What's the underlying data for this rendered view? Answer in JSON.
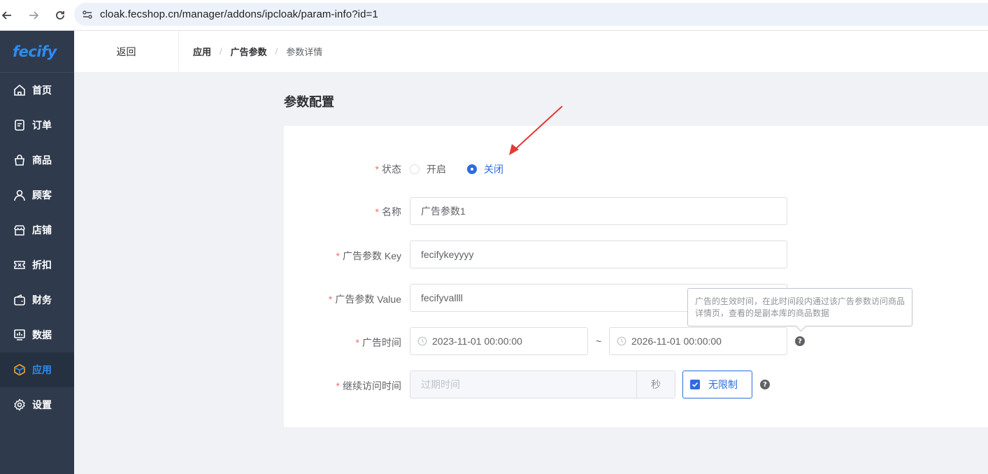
{
  "browser": {
    "url": "cloak.fecshop.cn/manager/addons/ipcloak/param-info?id=1"
  },
  "sidebar": {
    "logo": "fecify",
    "items": [
      {
        "label": "首页",
        "icon": "home-icon"
      },
      {
        "label": "订单",
        "icon": "order-icon"
      },
      {
        "label": "商品",
        "icon": "bag-icon"
      },
      {
        "label": "顾客",
        "icon": "user-icon"
      },
      {
        "label": "店铺",
        "icon": "store-icon"
      },
      {
        "label": "折扣",
        "icon": "ticket-icon"
      },
      {
        "label": "财务",
        "icon": "wallet-icon"
      },
      {
        "label": "数据",
        "icon": "chart-icon"
      },
      {
        "label": "应用",
        "icon": "cube-icon",
        "active": true
      },
      {
        "label": "设置",
        "icon": "gear-icon"
      }
    ],
    "accent": "#2d8cf0"
  },
  "header": {
    "back": "返回",
    "breadcrumb": [
      "应用",
      "广告参数",
      "参数详情"
    ]
  },
  "page": {
    "title": "参数配置"
  },
  "form": {
    "status": {
      "label": "状态",
      "options": [
        "开启",
        "关闭"
      ],
      "selected": "关闭"
    },
    "name": {
      "label": "名称",
      "value": "广告参数1"
    },
    "key": {
      "label": "广告参数 Key",
      "value": "fecifykeyyyy"
    },
    "value": {
      "label": "广告参数 Value",
      "value": "fecifyvallll"
    },
    "time": {
      "label": "广告时间",
      "start": "2023-11-01 00:00:00",
      "separator": "~",
      "end": "2026-11-01 00:00:00"
    },
    "revisit": {
      "label": "继续访问时间",
      "placeholder": "过期时间",
      "unit": "秒",
      "unlimited_label": "无限制",
      "unlimited_checked": true
    },
    "required_mark": "*"
  },
  "tooltip": {
    "text": "广告的生效时间，在此时间段内通过该广告参数访问商品详情页，查看的是副本库的商品数据"
  },
  "colors": {
    "primary": "#2d6cdf",
    "required": "#f56c6c",
    "annotation_arrow": "#e53935"
  }
}
